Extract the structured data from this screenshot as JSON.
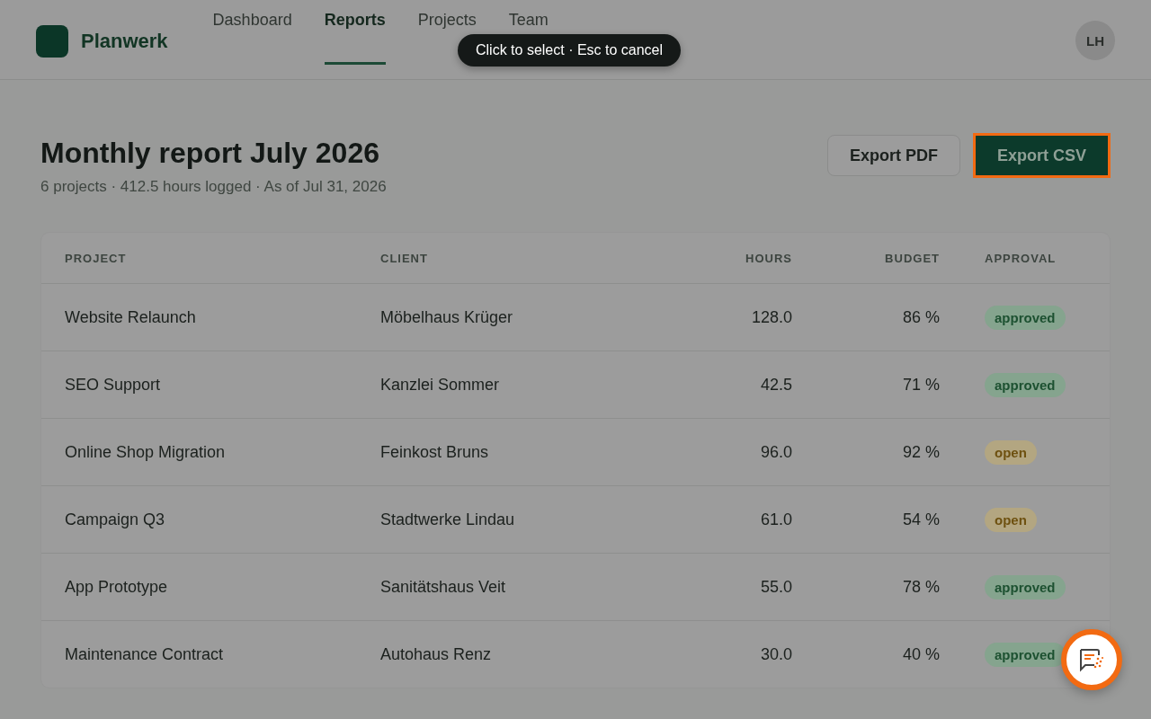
{
  "app": {
    "brand": "Planwerk",
    "nav": [
      {
        "label": "Dashboard",
        "selected": false
      },
      {
        "label": "Reports",
        "selected": true
      },
      {
        "label": "Projects",
        "selected": false
      },
      {
        "label": "Team",
        "selected": false
      }
    ],
    "avatar": "LH"
  },
  "tooltip": "Click to select · Esc to cancel",
  "report": {
    "title": "Monthly report July 2026",
    "subtitle": "6 projects · 412.5 hours logged · As of Jul 31, 2026",
    "buttons": [
      {
        "label": "Export PDF",
        "kind": "secondary",
        "outlined": false
      },
      {
        "label": "Export CSV",
        "kind": "primary",
        "outlined": true
      }
    ]
  },
  "table": {
    "columns": [
      "PROJECT",
      "CLIENT",
      "HOURS",
      "BUDGET",
      "APPROVAL"
    ],
    "rows": [
      {
        "project": "Website Relaunch",
        "client": "Möbelhaus Krüger",
        "hours": "128.0",
        "budget": "86 %",
        "approval": {
          "label": "approved",
          "kind": "approved"
        }
      },
      {
        "project": "SEO Support",
        "client": "Kanzlei Sommer",
        "hours": "42.5",
        "budget": "71 %",
        "approval": {
          "label": "approved",
          "kind": "approved"
        }
      },
      {
        "project": "Online Shop Migration",
        "client": "Feinkost Bruns",
        "hours": "96.0",
        "budget": "92 %",
        "approval": {
          "label": "open",
          "kind": "open"
        }
      },
      {
        "project": "Campaign Q3",
        "client": "Stadtwerke Lindau",
        "hours": "61.0",
        "budget": "54 %",
        "approval": {
          "label": "open",
          "kind": "open"
        }
      },
      {
        "project": "App Prototype",
        "client": "Sanitätshaus Veit",
        "hours": "55.0",
        "budget": "78 %",
        "approval": {
          "label": "approved",
          "kind": "approved"
        }
      },
      {
        "project": "Maintenance Contract",
        "client": "Autohaus Renz",
        "hours": "30.0",
        "budget": "40 %",
        "approval": {
          "label": "approved",
          "kind": "approved"
        }
      }
    ]
  }
}
